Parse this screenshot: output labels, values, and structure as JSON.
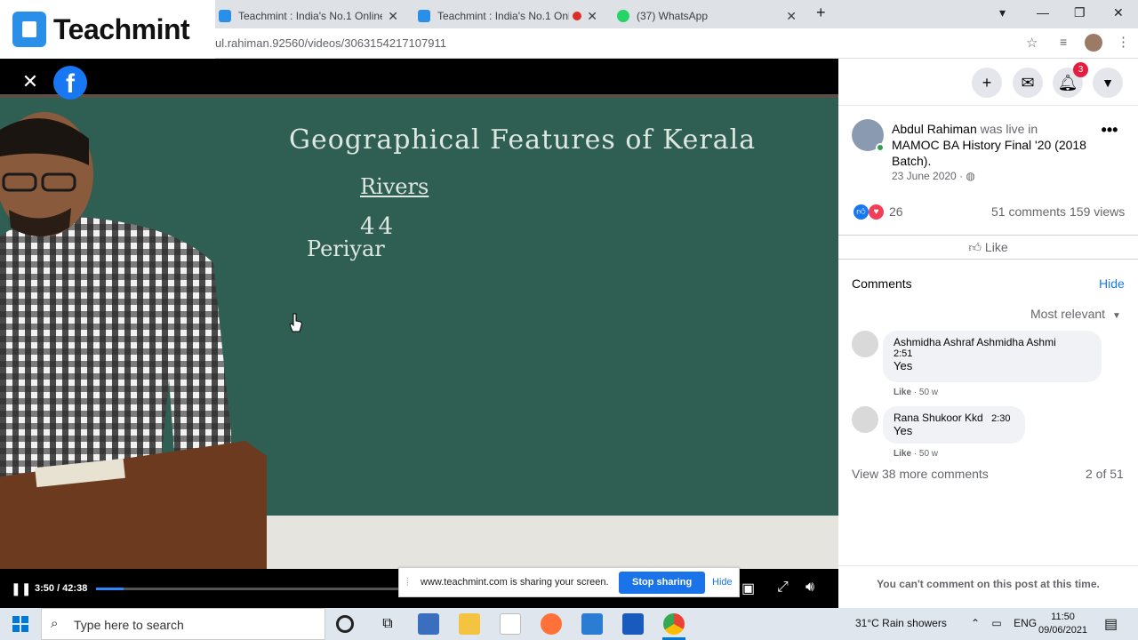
{
  "browser": {
    "tabs": [
      {
        "title": "Teachmint : India's No.1 Online t",
        "recording": false
      },
      {
        "title": "Teachmint : India's No.1 Onli",
        "recording": true
      },
      {
        "title": "(37) WhatsApp",
        "recording": false
      }
    ],
    "url": "ul.rahiman.92560/videos/3063154217107911"
  },
  "overlay": {
    "brand": "Teachmint"
  },
  "video": {
    "board_lines": [
      "Geographical Features of Kerala",
      "Rivers",
      "44",
      "Periyar"
    ],
    "time": "3:50 / 42:38",
    "progress": 0.09
  },
  "share_bar": {
    "message": "www.teachmint.com is sharing your screen.",
    "stop_label": "Stop sharing",
    "hide_label": "Hide"
  },
  "post": {
    "author": "Abdul Rahiman",
    "action": " was live in ",
    "group": "MAMOC BA History Final '20 (2018 Batch)",
    "suffix": ".",
    "date": "23 June 2020 · ",
    "reaction_count": "26",
    "comment_count": "51 comments",
    "view_count": "159 views",
    "like_label": "Like",
    "notif_count": "3"
  },
  "comments_section": {
    "title": "Comments",
    "hide_label": "Hide",
    "sort_label": "Most relevant",
    "items": [
      {
        "name": "Ashmidha Ashraf Ashmidha Ashmi",
        "time": "2:51",
        "text": "Yes",
        "like": "Like",
        "age": "50 w"
      },
      {
        "name": "Rana Shukoor Kkd",
        "time": "2:30",
        "text": "Yes",
        "like": "Like",
        "age": "50 w"
      }
    ],
    "view_more": "View 38 more comments",
    "page_count": "2 of 51",
    "cant_comment": "You can't comment on this post at this time."
  },
  "taskbar": {
    "search_placeholder": "Type here to search",
    "weather": "31°C  Rain showers",
    "lang": "ENG",
    "time": "11:50",
    "date": "09/06/2021"
  },
  "colors": {
    "facebook_blue": "#1877f2",
    "teachmint_blue": "#2a8fe8",
    "stop_share_blue": "#1a73e8"
  }
}
